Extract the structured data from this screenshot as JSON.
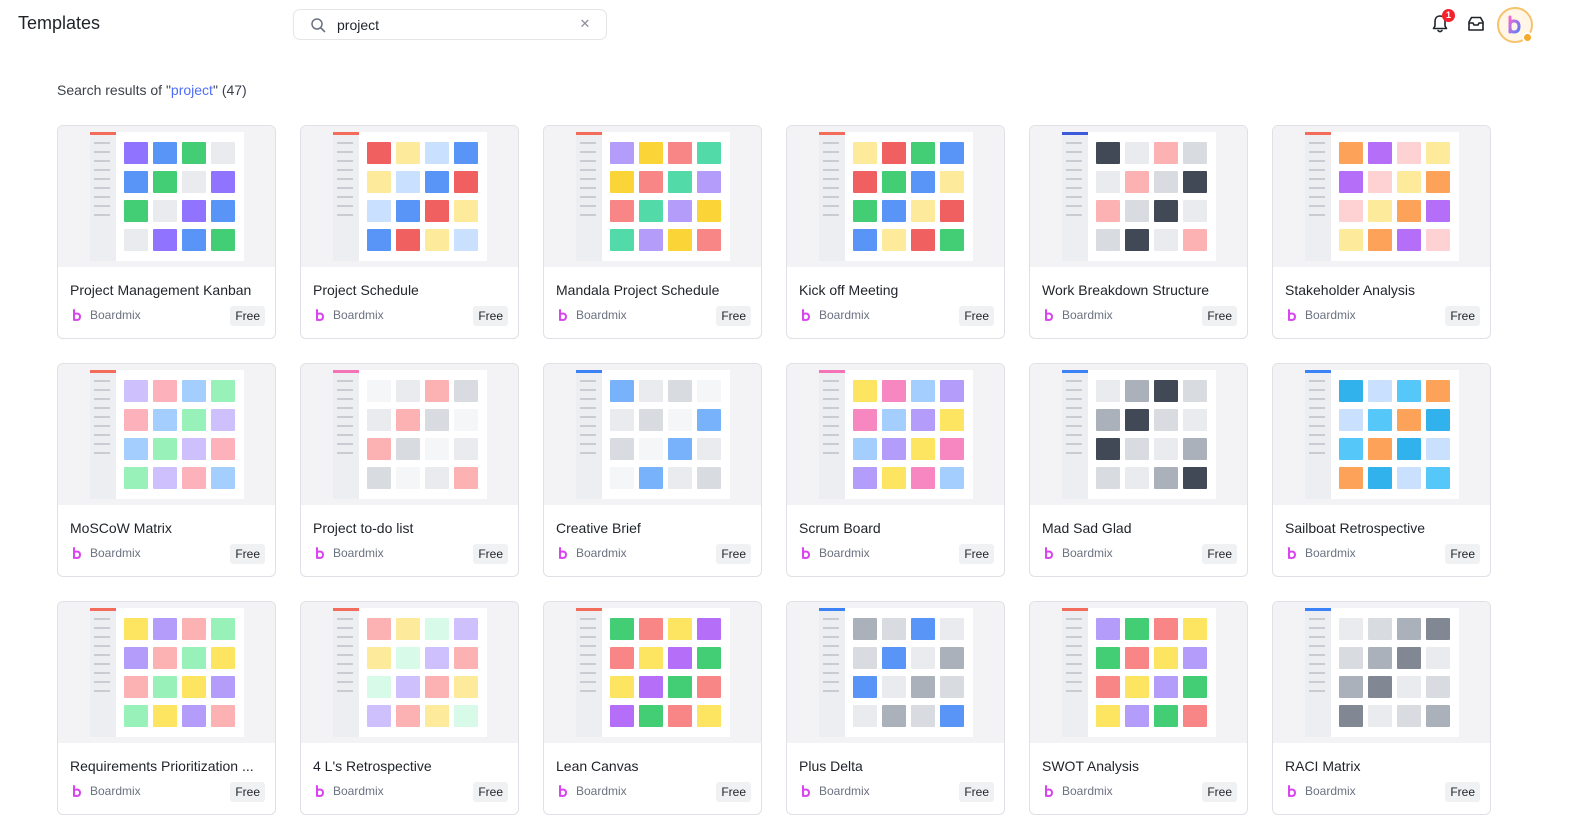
{
  "header": {
    "title": "Templates",
    "search": {
      "value": "project",
      "clear_icon": "close-icon",
      "search_icon": "search-icon"
    },
    "notifications": {
      "icon": "bell-icon",
      "badge": "1"
    },
    "inbox_icon": "inbox-icon",
    "avatar_icon": "boardmix-avatar"
  },
  "results": {
    "prefix": "Search results of \"",
    "query": "project",
    "suffix": "\" (47)"
  },
  "colors": {
    "accent": "#4f6ef7",
    "badge_red": "#f5222d"
  },
  "cards": [
    {
      "title": "Project Management Kanban",
      "author": "Boardmix",
      "price": "Free",
      "accent": "#f26b5b",
      "palette": [
        "#7c5cff",
        "#3b82f6",
        "#22c55e",
        "#e5e7eb"
      ]
    },
    {
      "title": "Project Schedule",
      "author": "Boardmix",
      "price": "Free",
      "accent": "#f26b5b",
      "palette": [
        "#3b82f6",
        "#ef4444",
        "#fde68a",
        "#bfdbfe"
      ]
    },
    {
      "title": "Mandala Project Schedule",
      "author": "Boardmix",
      "price": "Free",
      "accent": "#f26b5b",
      "palette": [
        "#f87171",
        "#34d399",
        "#a78bfa",
        "#facc15"
      ]
    },
    {
      "title": "Kick off Meeting",
      "author": "Boardmix",
      "price": "Free",
      "accent": "#f26b5b",
      "palette": [
        "#ef4444",
        "#22c55e",
        "#3b82f6",
        "#fde68a"
      ]
    },
    {
      "title": "Work Breakdown Structure",
      "author": "Boardmix",
      "price": "Free",
      "accent": "#3b5bdb",
      "palette": [
        "#1f2937",
        "#e5e7eb",
        "#fca5a5",
        "#d1d5db"
      ]
    },
    {
      "title": "Stakeholder Analysis",
      "author": "Boardmix",
      "price": "Free",
      "accent": "#f26b5b",
      "palette": [
        "#fde68a",
        "#fb923c",
        "#a855f7",
        "#fecaca"
      ]
    },
    {
      "title": "MoSCoW Matrix",
      "author": "Boardmix",
      "price": "Free",
      "accent": "#f26b5b",
      "palette": [
        "#93c5fd",
        "#86efac",
        "#c4b5fd",
        "#fda4af"
      ]
    },
    {
      "title": "Project to-do list",
      "author": "Boardmix",
      "price": "Free",
      "accent": "#f472b6",
      "palette": [
        "#e5e7eb",
        "#fca5a5",
        "#d1d5db",
        "#f3f4f6"
      ]
    },
    {
      "title": "Creative Brief",
      "author": "Boardmix",
      "price": "Free",
      "accent": "#3b82f6",
      "palette": [
        "#60a5fa",
        "#e5e7eb",
        "#d1d5db",
        "#f3f4f6"
      ]
    },
    {
      "title": "Scrum Board",
      "author": "Boardmix",
      "price": "Free",
      "accent": "#f472b6",
      "palette": [
        "#a78bfa",
        "#fde047",
        "#f472b6",
        "#93c5fd"
      ]
    },
    {
      "title": "Mad Sad Glad",
      "author": "Boardmix",
      "price": "Free",
      "accent": "#3b82f6",
      "palette": [
        "#1f2937",
        "#d1d5db",
        "#e5e7eb",
        "#9ca3af"
      ]
    },
    {
      "title": "Sailboat Retrospective",
      "author": "Boardmix",
      "price": "Free",
      "accent": "#3b82f6",
      "palette": [
        "#bfdbfe",
        "#38bdf8",
        "#fb923c",
        "#0ea5e9"
      ]
    },
    {
      "title": "Requirements Prioritization ...",
      "author": "Boardmix",
      "price": "Free",
      "accent": "#f26b5b",
      "palette": [
        "#fde047",
        "#a78bfa",
        "#fca5a5",
        "#86efac"
      ]
    },
    {
      "title": "4 L's Retrospective",
      "author": "Boardmix",
      "price": "Free",
      "accent": "#f26b5b",
      "palette": [
        "#c4b5fd",
        "#fca5a5",
        "#fde68a",
        "#d1fae5"
      ]
    },
    {
      "title": "Lean Canvas",
      "author": "Boardmix",
      "price": "Free",
      "accent": "#f26b5b",
      "palette": [
        "#fde047",
        "#a855f7",
        "#22c55e",
        "#f87171"
      ]
    },
    {
      "title": "Plus Delta",
      "author": "Boardmix",
      "price": "Free",
      "accent": "#3b82f6",
      "palette": [
        "#d1d5db",
        "#3b82f6",
        "#e5e7eb",
        "#9ca3af"
      ]
    },
    {
      "title": "SWOT Analysis",
      "author": "Boardmix",
      "price": "Free",
      "accent": "#f26b5b",
      "palette": [
        "#a78bfa",
        "#22c55e",
        "#f87171",
        "#fde047"
      ]
    },
    {
      "title": "RACI Matrix",
      "author": "Boardmix",
      "price": "Free",
      "accent": "#3b82f6",
      "palette": [
        "#6b7280",
        "#e5e7eb",
        "#d1d5db",
        "#9ca3af"
      ]
    }
  ]
}
